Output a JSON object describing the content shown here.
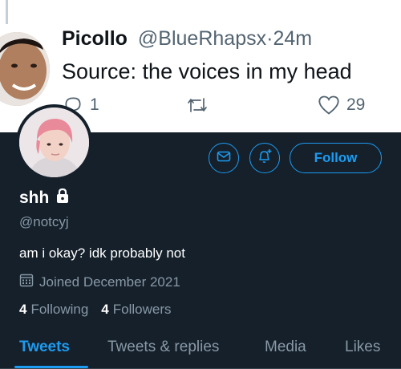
{
  "quoted_tweet": {
    "author_name": "Picollo",
    "author_handle": "@BlueRhapsx",
    "separator": "·",
    "timestamp": "24m",
    "text": "Source: the voices in my head",
    "reply_count": "1",
    "like_count": "29"
  },
  "profile": {
    "display_name": "shh",
    "username": "@notcyj",
    "bio": "am i okay? idk probably not",
    "joined": "Joined December 2021",
    "following_count": "4",
    "following_label": "Following",
    "followers_count": "4",
    "followers_label": "Followers",
    "follow_button": "Follow"
  },
  "tabs": [
    {
      "label": "Tweets",
      "active": true
    },
    {
      "label": "Tweets & replies",
      "active": false
    },
    {
      "label": "Media",
      "active": false
    },
    {
      "label": "Likes",
      "active": false
    }
  ],
  "colors": {
    "accent": "#1d9bf0",
    "background": "#15202b",
    "muted_text": "#8899a6"
  },
  "icons": {
    "reply": "reply-icon",
    "retweet": "retweet-icon",
    "like": "heart-icon",
    "message": "mail-icon",
    "notifications": "bell-plus-icon",
    "protected": "lock-icon",
    "joined": "calendar-icon"
  }
}
